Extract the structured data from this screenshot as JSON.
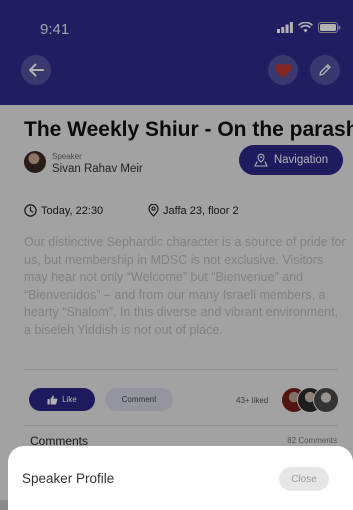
{
  "status_bar": {
    "time": "9:41"
  },
  "header": {
    "back_icon": "arrow-left-icon",
    "favorite_icon": "heart-icon",
    "edit_icon": "pencil-icon",
    "favorite_color": "#c0392b"
  },
  "event": {
    "title": "The Weekly Shiur - On the parasha",
    "speaker_label": "Speaker",
    "speaker_name": "Sivan Rahav Meir",
    "navigation_label": "Navigation",
    "time": "Today, 22:30",
    "location": "Jaffa 23, floor 2",
    "description": "Our distinctive Sephardic character is a source of pride for us, but membership in MDSC is not exclusive. Visitors may hear not only “Welcome” but “Bienvenue” and “Bienvenidos” – and from our many Israeli members, a hearty “Shalom”. In this diverse and vibrant environment, a biseleh Yiddish is not out of place."
  },
  "actions": {
    "like_label": "Like",
    "comment_label": "Comment",
    "liked_count": "43+ liked"
  },
  "comments": {
    "title": "Comments",
    "count": "82 Comments"
  },
  "sheet": {
    "title": "Speaker Profile",
    "close_label": "Close"
  },
  "colors": {
    "header": "#2f2b8c",
    "accent": "#2b2788"
  }
}
